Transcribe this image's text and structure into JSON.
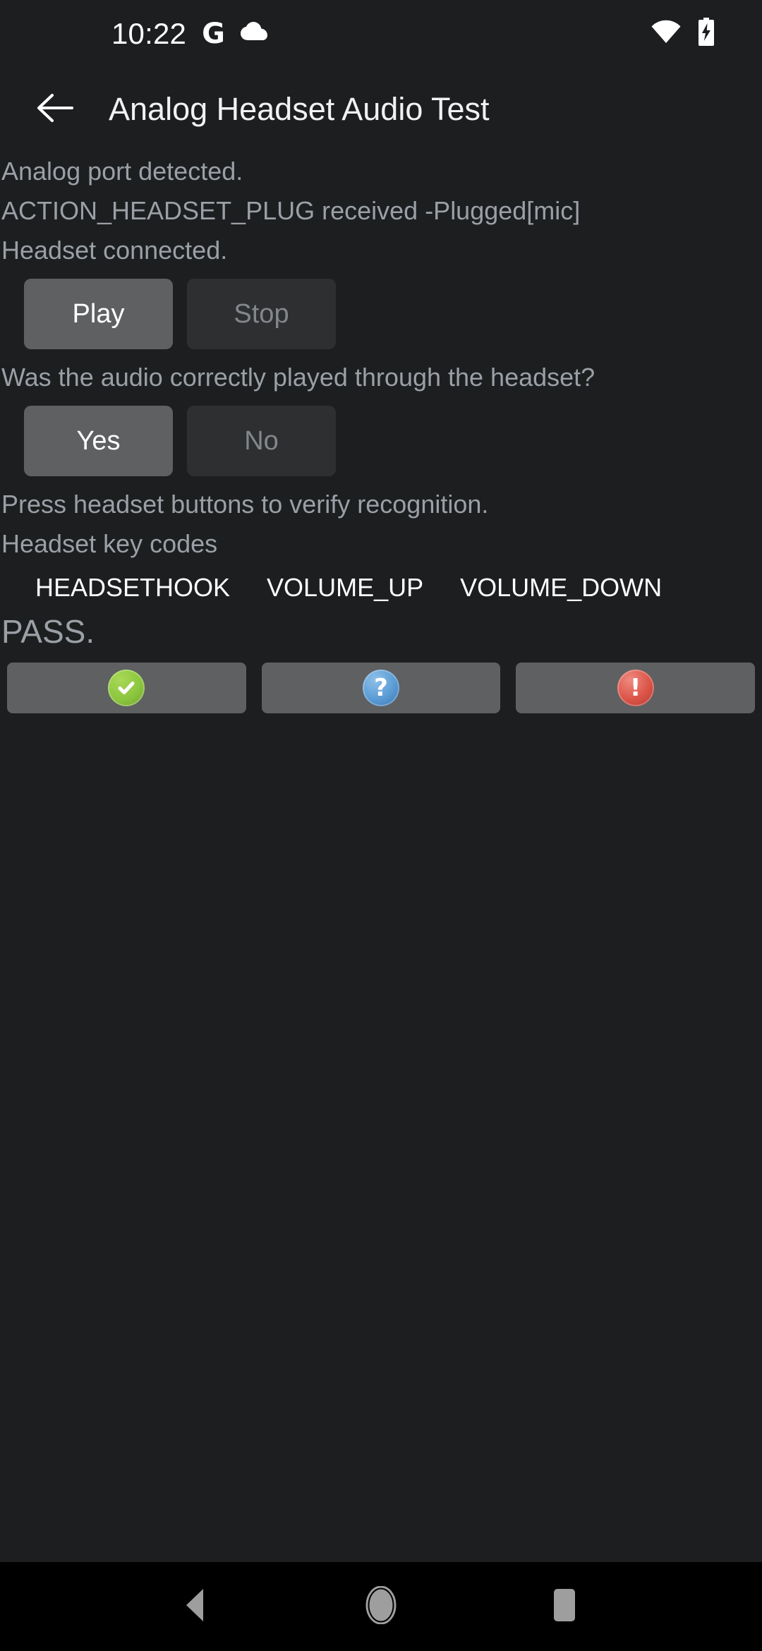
{
  "status_bar": {
    "clock": "10:22",
    "icons": [
      "google-g-icon",
      "cloud-icon",
      "wifi-icon",
      "battery-charging-icon"
    ]
  },
  "app_bar": {
    "back_icon": "arrow-back-icon",
    "title": "Analog Headset Audio Test"
  },
  "content": {
    "log_lines": [
      "Analog port detected.",
      "ACTION_HEADSET_PLUG received -Plugged[mic]",
      "Headset connected."
    ],
    "playback_controls": [
      {
        "label": "Play",
        "state": "enabled"
      },
      {
        "label": "Stop",
        "state": "disabled"
      }
    ],
    "question": "Was the audio correctly played through the headset?",
    "answer_controls": [
      {
        "label": "Yes",
        "state": "enabled"
      },
      {
        "label": "No",
        "state": "disabled"
      }
    ],
    "instruction": "Press headset buttons to verify recognition.",
    "keycodes_label": "Headset key codes",
    "keycodes": [
      "HEADSETHOOK",
      "VOLUME_UP",
      "VOLUME_DOWN"
    ],
    "verdict": "PASS."
  },
  "actions": [
    {
      "name": "pass-button",
      "icon": "check-circle-icon",
      "glyph": "✔",
      "color": "#8cc63e"
    },
    {
      "name": "info-button",
      "icon": "question-circle-icon",
      "glyph": "?",
      "color": "#5a9bd5"
    },
    {
      "name": "fail-button",
      "icon": "exclamation-circle-icon",
      "glyph": "!",
      "color": "#db5448"
    }
  ],
  "nav_bar": {
    "back": "nav-back-icon",
    "home": "nav-home-icon",
    "recents": "nav-recents-icon"
  }
}
